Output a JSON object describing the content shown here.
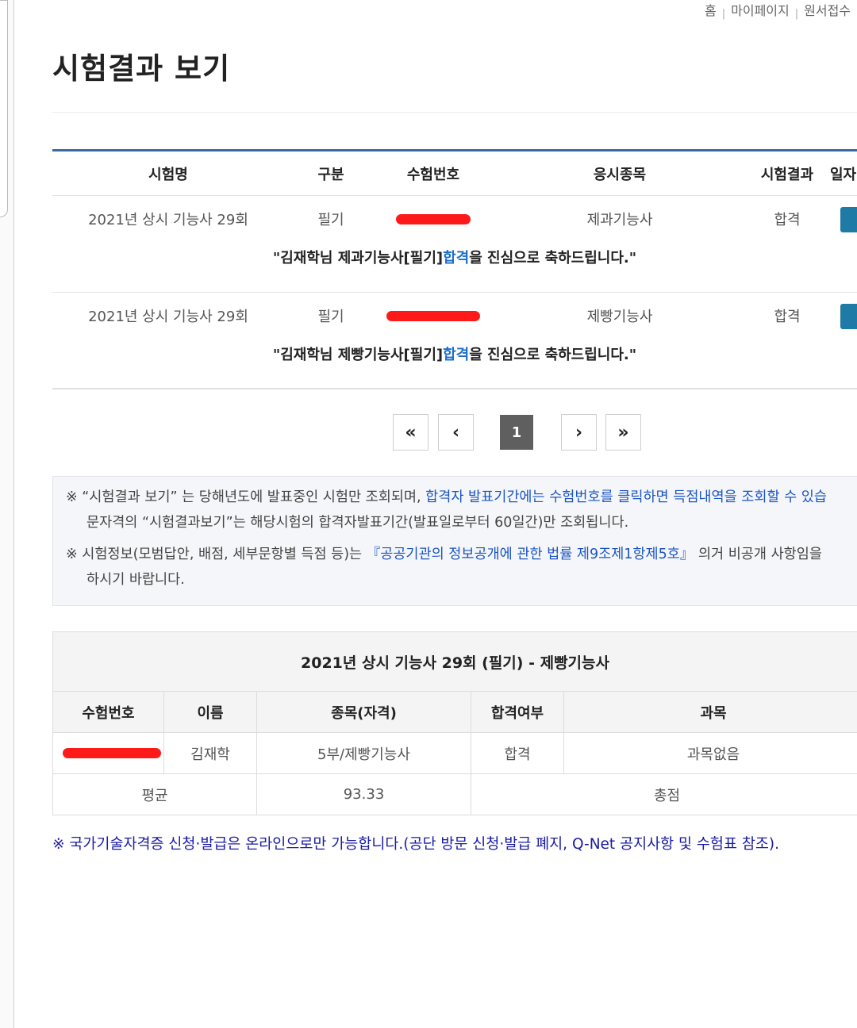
{
  "util_nav": {
    "home": "홈",
    "mypage": "마이페이지",
    "apply": "원서접수"
  },
  "page_title": "시험결과 보기",
  "results_table": {
    "headers": {
      "exam_name": "시험명",
      "category": "구분",
      "exam_number": "수험번호",
      "subject": "응시종목",
      "result": "시험결과",
      "date": "일자"
    },
    "rows": [
      {
        "exam_name": "2021년 상시 기능사 29회",
        "category": "필기",
        "subject": "제과기능사",
        "result": "합격",
        "msg_prefix": "\"김재학님 제과기능사[필기] ",
        "msg_pass": "합격",
        "msg_suffix": "을 진심으로 축하드립니다.\""
      },
      {
        "exam_name": "2021년 상시 기능사 29회",
        "category": "필기",
        "subject": "제빵기능사",
        "result": "합격",
        "msg_prefix": "\"김재학님 제빵기능사[필기] ",
        "msg_pass": "합격",
        "msg_suffix": "을 진심으로 축하드립니다.\""
      }
    ]
  },
  "pagination": {
    "first": "«",
    "prev": "‹",
    "current": "1",
    "next": "›",
    "last": "»"
  },
  "notice": {
    "line1_a": "※ “시험결과 보기” 는 당해년도에 발표중인 시험만 조회되며, ",
    "line1_b": "합격자 발표기간에는 수험번호를 클릭하면 득점내역을 조회할 수 있습",
    "line1_c": "문자격의 “시험결과보기”는 해당시험의 합격자발표기간(발표일로부터 60일간)만 조회됩니다.",
    "line2_a": "※ 시험정보(모범답안, 배점, 세부문항별 득점 등)는 ",
    "line2_b": "『공공기관의 정보공개에 관한 법률 제9조제1항제5호』",
    "line2_c": " 의거 비공개 사항임을",
    "line2_d": "하시기 바랍니다."
  },
  "score_table": {
    "caption": "2021년 상시 기능사 29회 (필기) - 제빵기능사",
    "headers": {
      "exam_number": "수험번호",
      "name": "이름",
      "field": "종목(자격)",
      "pass": "합격여부",
      "subjects": "과목"
    },
    "row": {
      "name": "김재학",
      "field": "5부/제빵기능사",
      "pass": "합격",
      "subjects": "과목없음"
    },
    "summary": {
      "avg_label": "평균",
      "avg_value": "93.33",
      "total_label": "총점"
    }
  },
  "footer_note": "※ 국가기술자격증 신청·발급은 온라인으로만 가능합니다.(공단 방문 신청·발급 폐지, Q-Net 공지사항 및 수험표 참조).",
  "colors": {
    "accent_blue": "#1a6fc9",
    "header_line": "#3b6aa0",
    "button_blue": "#1f7aa6",
    "redaction": "#ff1a1a",
    "footer_note": "#1a1aa6"
  }
}
